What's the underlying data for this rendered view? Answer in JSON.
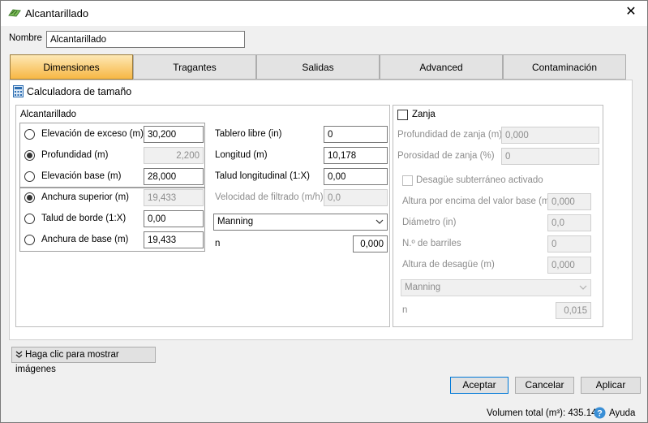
{
  "window": {
    "title": "Alcantarillado",
    "close_glyph": "✕"
  },
  "nombre": {
    "label": "Nombre",
    "value": "Alcantarillado"
  },
  "tabs": [
    {
      "label": "Dimensiones",
      "active": true
    },
    {
      "label": "Tragantes"
    },
    {
      "label": "Salidas"
    },
    {
      "label": "Advanced"
    },
    {
      "label": "Contaminación"
    }
  ],
  "calculator": {
    "label": "Calculadora de tamaño",
    "icon": "calculator-icon"
  },
  "alcantarillado": {
    "title": "Alcantarillado",
    "rows": [
      {
        "label": "Elevación de exceso (m)",
        "value": "30,200"
      },
      {
        "label": "Profundidad (m)",
        "value": "2,200"
      },
      {
        "label": "Elevación base (m)",
        "value": "28,000"
      },
      {
        "label": "Anchura superior (m)",
        "value": "19,433"
      },
      {
        "label": "Talud de borde (1:X)",
        "value": "0,00"
      },
      {
        "label": "Anchura de base (m)",
        "value": "19,433"
      }
    ],
    "right": [
      {
        "label": "Tablero libre (in)",
        "value": "0"
      },
      {
        "label": "Longitud (m)",
        "value": "10,178"
      },
      {
        "label": "Talud longitudinal (1:X)",
        "value": "0,00"
      },
      {
        "label": "Velocidad de filtrado (m/h)",
        "value": "0,0"
      }
    ],
    "method": "Manning",
    "n_label": "n",
    "n_value": "0,000"
  },
  "zanja": {
    "label": "Zanja",
    "rows": [
      {
        "label": "Profundidad de zanja (m)",
        "value": "0,000"
      },
      {
        "label": "Porosidad de zanja (%)",
        "value": "0"
      }
    ],
    "drain_label": "Desagüe subterráneo activado",
    "drain_rows": [
      {
        "label": "Altura por encima del valor base (m)",
        "value": "0,000"
      },
      {
        "label": "Diámetro (in)",
        "value": "0,0"
      },
      {
        "label": "N.º de barriles",
        "value": "0"
      },
      {
        "label": "Altura de desagüe (m)",
        "value": "0,000"
      }
    ],
    "method": "Manning",
    "n_label": "n",
    "n_value": "0,015"
  },
  "show_images": "Haga clic para mostrar imágenes",
  "buttons": {
    "ok": "Aceptar",
    "cancel": "Cancelar",
    "apply": "Aplicar"
  },
  "status": {
    "volume": "Volumen total (m³): 435.145",
    "help": "Ayuda"
  }
}
